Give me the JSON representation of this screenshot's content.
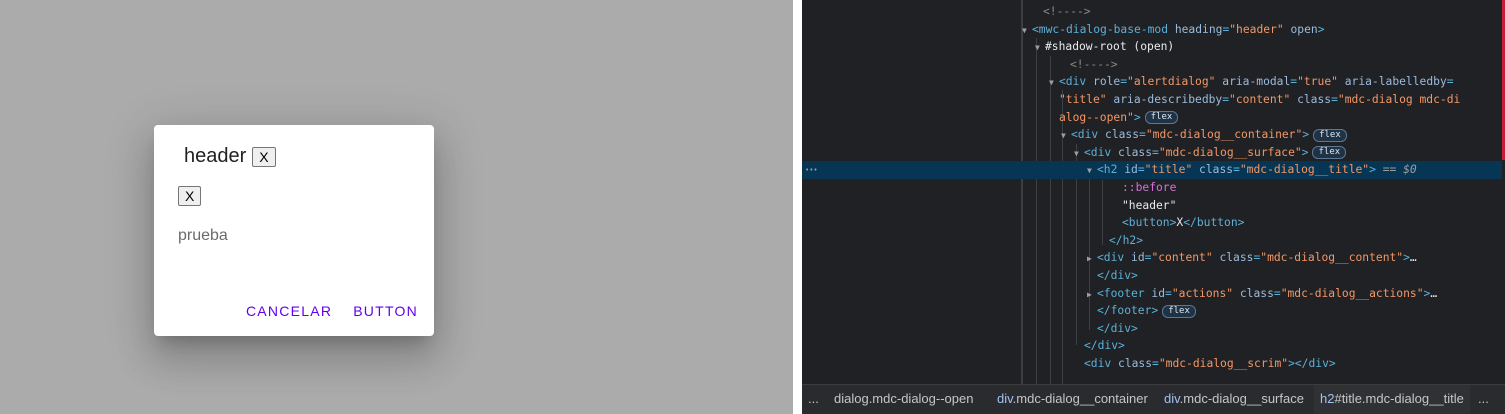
{
  "dialog": {
    "heading": "header",
    "title_button": "X",
    "content_button": "X",
    "content_text": "prueba",
    "actions": [
      "CANCELAR",
      "BUTTON"
    ],
    "accent_color": "#6200ee"
  },
  "devtools": {
    "lines": [
      {
        "depth": 0,
        "indent": 1043,
        "parts": [
          {
            "c": "cm",
            "t": "<!---->"
          }
        ]
      },
      {
        "depth": 0,
        "indent": 1032,
        "tri": "▼",
        "parts": [
          {
            "c": "tag",
            "t": "<mwc-dialog-base-mod "
          },
          {
            "c": "an",
            "t": "heading"
          },
          {
            "c": "tag",
            "t": "="
          },
          {
            "c": "av",
            "t": "\"header\""
          },
          {
            "c": "an",
            "t": " open"
          },
          {
            "c": "tag",
            "t": ">"
          }
        ]
      },
      {
        "depth": 1,
        "indent": 1045,
        "tri": "▼",
        "parts": [
          {
            "c": "tx",
            "t": "#shadow-root (open)"
          }
        ]
      },
      {
        "depth": 2,
        "indent": 1070,
        "parts": [
          {
            "c": "cm",
            "t": "<!---->"
          }
        ]
      },
      {
        "depth": 2,
        "indent": 1059,
        "tri": "▼",
        "parts": [
          {
            "c": "tag",
            "t": "<div "
          },
          {
            "c": "an",
            "t": "role"
          },
          {
            "c": "tag",
            "t": "="
          },
          {
            "c": "av",
            "t": "\"alertdialog\""
          },
          {
            "c": "an",
            "t": " aria-modal"
          },
          {
            "c": "tag",
            "t": "="
          },
          {
            "c": "av",
            "t": "\"true\""
          },
          {
            "c": "an",
            "t": " aria-labelledby"
          },
          {
            "c": "tag",
            "t": "="
          }
        ]
      },
      {
        "depth": 2,
        "indent": 1059,
        "parts": [
          {
            "c": "av",
            "t": "\"title\""
          },
          {
            "c": "an",
            "t": " aria-describedby"
          },
          {
            "c": "tag",
            "t": "="
          },
          {
            "c": "av",
            "t": "\"content\""
          },
          {
            "c": "an",
            "t": " class"
          },
          {
            "c": "tag",
            "t": "="
          },
          {
            "c": "av",
            "t": "\"mdc-dialog mdc-di"
          }
        ]
      },
      {
        "depth": 2,
        "indent": 1059,
        "badge": "flex",
        "parts": [
          {
            "c": "av",
            "t": "alog--open\""
          },
          {
            "c": "tag",
            "t": ">"
          }
        ]
      },
      {
        "depth": 3,
        "indent": 1071,
        "tri": "▼",
        "badge": "flex",
        "parts": [
          {
            "c": "tag",
            "t": "<div "
          },
          {
            "c": "an",
            "t": "class"
          },
          {
            "c": "tag",
            "t": "="
          },
          {
            "c": "av",
            "t": "\"mdc-dialog__container\""
          },
          {
            "c": "tag",
            "t": ">"
          }
        ]
      },
      {
        "depth": 4,
        "indent": 1084,
        "tri": "▼",
        "badge": "flex",
        "parts": [
          {
            "c": "tag",
            "t": "<div "
          },
          {
            "c": "an",
            "t": "class"
          },
          {
            "c": "tag",
            "t": "="
          },
          {
            "c": "av",
            "t": "\"mdc-dialog__surface\""
          },
          {
            "c": "tag",
            "t": ">"
          }
        ]
      },
      {
        "depth": 5,
        "indent": 1097,
        "tri": "▼",
        "sel": true,
        "eq": " == $0",
        "parts": [
          {
            "c": "tag",
            "t": "<h2 "
          },
          {
            "c": "an",
            "t": "id"
          },
          {
            "c": "tag",
            "t": "="
          },
          {
            "c": "av",
            "t": "\"title\""
          },
          {
            "c": "an",
            "t": " class"
          },
          {
            "c": "tag",
            "t": "="
          },
          {
            "c": "av",
            "t": "\"mdc-dialog__title\""
          },
          {
            "c": "tag",
            "t": ">"
          }
        ]
      },
      {
        "depth": 6,
        "indent": 1122,
        "parts": [
          {
            "c": "pseudo",
            "t": "::before"
          }
        ]
      },
      {
        "depth": 6,
        "indent": 1122,
        "parts": [
          {
            "c": "tx",
            "t": "\"header\""
          }
        ]
      },
      {
        "depth": 6,
        "indent": 1122,
        "parts": [
          {
            "c": "tag",
            "t": "<button>"
          },
          {
            "c": "tx",
            "t": "X"
          },
          {
            "c": "tag",
            "t": "</button>"
          }
        ]
      },
      {
        "depth": 5,
        "indent": 1109,
        "parts": [
          {
            "c": "tag",
            "t": "</h2>"
          }
        ]
      },
      {
        "depth": 5,
        "indent": 1097,
        "tri": "▶",
        "parts": [
          {
            "c": "tag",
            "t": "<div "
          },
          {
            "c": "an",
            "t": "id"
          },
          {
            "c": "tag",
            "t": "="
          },
          {
            "c": "av",
            "t": "\"content\""
          },
          {
            "c": "an",
            "t": " class"
          },
          {
            "c": "tag",
            "t": "="
          },
          {
            "c": "av",
            "t": "\"mdc-dialog__content\""
          },
          {
            "c": "tag",
            "t": ">"
          },
          {
            "c": "tx",
            "t": "…"
          }
        ]
      },
      {
        "depth": 5,
        "indent": 1097,
        "parts": [
          {
            "c": "tag",
            "t": "</div>"
          }
        ]
      },
      {
        "depth": 5,
        "indent": 1097,
        "tri": "▶",
        "parts": [
          {
            "c": "tag",
            "t": "<footer "
          },
          {
            "c": "an",
            "t": "id"
          },
          {
            "c": "tag",
            "t": "="
          },
          {
            "c": "av",
            "t": "\"actions\""
          },
          {
            "c": "an",
            "t": " class"
          },
          {
            "c": "tag",
            "t": "="
          },
          {
            "c": "av",
            "t": "\"mdc-dialog__actions\""
          },
          {
            "c": "tag",
            "t": ">"
          },
          {
            "c": "tx",
            "t": "…"
          }
        ]
      },
      {
        "depth": 5,
        "indent": 1097,
        "badge": "flex",
        "parts": [
          {
            "c": "tag",
            "t": "</footer>"
          }
        ]
      },
      {
        "depth": 4,
        "indent": 1097,
        "parts": [
          {
            "c": "tag",
            "t": "</div>"
          }
        ]
      },
      {
        "depth": 3,
        "indent": 1084,
        "parts": [
          {
            "c": "tag",
            "t": "</div>"
          }
        ]
      },
      {
        "depth": 3,
        "indent": 1084,
        "parts": [
          {
            "c": "tag",
            "t": "<div "
          },
          {
            "c": "an",
            "t": "class"
          },
          {
            "c": "tag",
            "t": "="
          },
          {
            "c": "av",
            "t": "\"mdc-dialog__scrim\""
          },
          {
            "c": "tag",
            "t": "></div>"
          }
        ]
      }
    ],
    "breadcrumbs": [
      {
        "text": "...",
        "tag": ""
      },
      {
        "text": "dialog.mdc-dialog--open",
        "tag": ""
      },
      {
        "text": ".mdc-dialog__container",
        "tag": "div"
      },
      {
        "text": ".mdc-dialog__surface",
        "tag": "div"
      },
      {
        "text": "#title.mdc-dialog__title",
        "tag": "h2"
      },
      {
        "text": "...",
        "tag": ""
      }
    ]
  }
}
